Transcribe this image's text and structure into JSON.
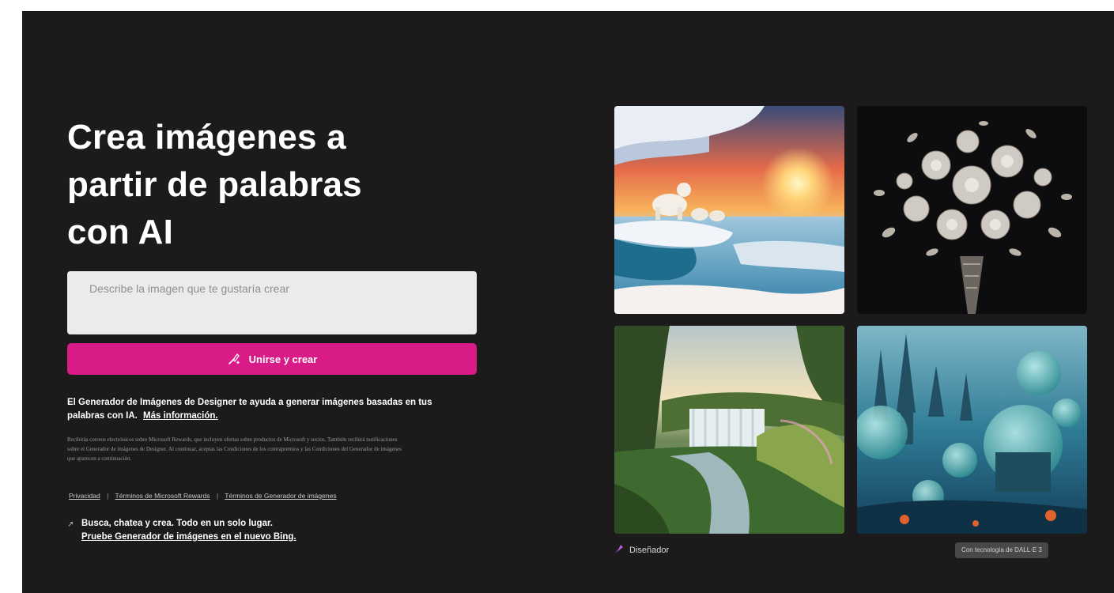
{
  "hero": {
    "title_lines": [
      "Crea imágenes a",
      "partir de palabras",
      "con AI"
    ]
  },
  "prompt": {
    "placeholder": "Describe la imagen que te gustaría crear",
    "value": ""
  },
  "create_button": {
    "label": "Unirse y crear",
    "icon": "brush-sparkle-icon"
  },
  "intro": {
    "text": "El Generador de Imágenes de Designer te ayuda a generar imágenes basadas en tus palabras con IA.",
    "link": "Más información."
  },
  "fine_print": "Recibirás correos electrónicos sobre Microsoft Rewards, que incluyen ofertas sobre productos de Microsoft y socios. También recibirá notificaciones sobre el Generador de imágenes de Designer. Al continuar, aceptas las Condiciones de los contrapremios y las Condiciones del Generador de imágenes que aparecen a continuación.",
  "legal_links": [
    "Privacidad",
    "Términos de Microsoft Rewards",
    "Términos de Generador de imágenes"
  ],
  "promo": {
    "icon": "arrow-icon",
    "text": "Busca, chatea y crea. Todo en un solo lugar.",
    "link": "Pruebe Generador de imágenes en el nuevo Bing."
  },
  "gallery": [
    {
      "name": "polar-bears-ice-sunset-image"
    },
    {
      "name": "jeweled-flower-bouquet-image"
    },
    {
      "name": "jungle-waterfall-image"
    },
    {
      "name": "underwater-dome-city-image"
    }
  ],
  "footer": {
    "brand_name": "Diseñador",
    "brand_icon": "designer-logo-icon",
    "powered_by": "Con tecnología de DALL·E 3"
  },
  "colors": {
    "background": "#1c1a1b",
    "accent": "#d81b87",
    "input": "#ebebeb"
  }
}
